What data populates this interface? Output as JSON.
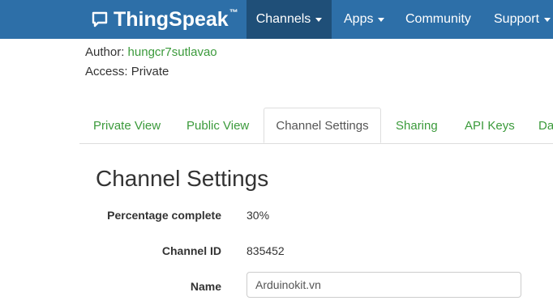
{
  "nav": {
    "brand": "ThingSpeak",
    "brand_tm": "™",
    "items": [
      {
        "label": "Channels"
      },
      {
        "label": "Apps"
      },
      {
        "label": "Community"
      },
      {
        "label": "Support"
      }
    ]
  },
  "meta": {
    "author_label": "Author:",
    "author_value": "hungcr7sutlavao",
    "access_label": "Access:",
    "access_value": "Private"
  },
  "tabs": [
    {
      "label": "Private View"
    },
    {
      "label": "Public View"
    },
    {
      "label": "Channel Settings"
    },
    {
      "label": "Sharing"
    },
    {
      "label": "API Keys"
    },
    {
      "label": "Da"
    }
  ],
  "settings": {
    "title": "Channel Settings",
    "percentage_label": "Percentage complete",
    "percentage_value": "30%",
    "channel_id_label": "Channel ID",
    "channel_id_value": "835452",
    "name_label": "Name",
    "name_value": "Arduinokit.vn"
  },
  "colors": {
    "navbar": "#2d6fa8",
    "navbar_active": "#1f4f78",
    "link": "#3b9a3b"
  }
}
